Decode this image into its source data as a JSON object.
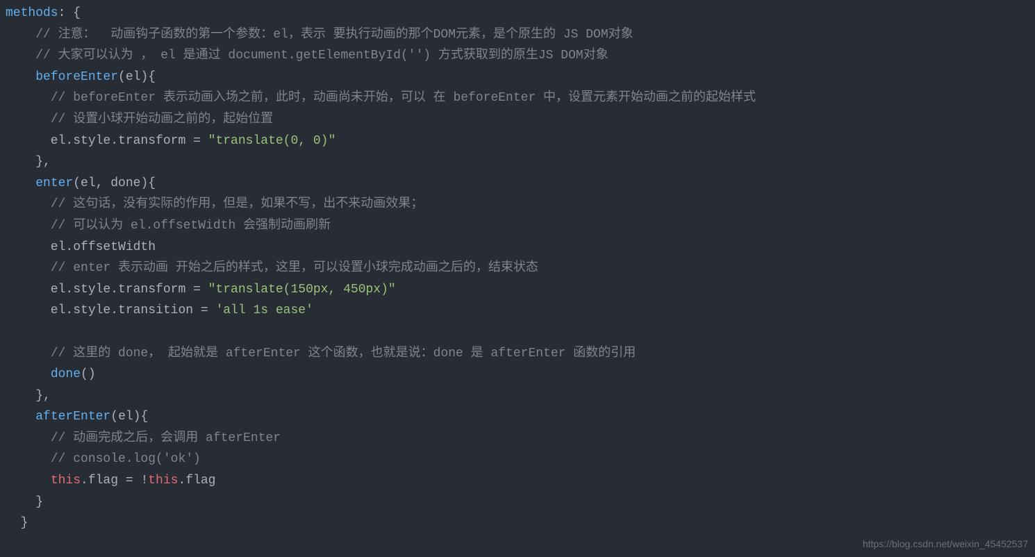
{
  "lines": [
    {
      "segments": [
        {
          "cls": "method",
          "text": "methods"
        },
        {
          "cls": "punct",
          "text": ": {"
        }
      ]
    },
    {
      "segments": [
        {
          "cls": "plain",
          "text": "    "
        },
        {
          "cls": "comment",
          "text": "// 注意：  动画钩子函数的第一个参数：el，表示 要执行动画的那个DOM元素，是个原生的 JS DOM对象"
        }
      ]
    },
    {
      "segments": [
        {
          "cls": "plain",
          "text": "    "
        },
        {
          "cls": "comment",
          "text": "// 大家可以认为 ， el 是通过 document.getElementById('') 方式获取到的原生JS DOM对象"
        }
      ]
    },
    {
      "segments": [
        {
          "cls": "plain",
          "text": "    "
        },
        {
          "cls": "method",
          "text": "beforeEnter"
        },
        {
          "cls": "punct",
          "text": "("
        },
        {
          "cls": "param",
          "text": "el"
        },
        {
          "cls": "punct",
          "text": "){"
        }
      ]
    },
    {
      "segments": [
        {
          "cls": "plain",
          "text": "      "
        },
        {
          "cls": "comment",
          "text": "// beforeEnter 表示动画入场之前，此时，动画尚未开始，可以 在 beforeEnter 中，设置元素开始动画之前的起始样式"
        }
      ]
    },
    {
      "segments": [
        {
          "cls": "plain",
          "text": "      "
        },
        {
          "cls": "comment",
          "text": "// 设置小球开始动画之前的，起始位置"
        }
      ]
    },
    {
      "segments": [
        {
          "cls": "plain",
          "text": "      el.style.transform = "
        },
        {
          "cls": "string",
          "text": "\"translate(0, 0)\""
        }
      ]
    },
    {
      "segments": [
        {
          "cls": "plain",
          "text": "    },"
        }
      ]
    },
    {
      "segments": [
        {
          "cls": "plain",
          "text": "    "
        },
        {
          "cls": "method",
          "text": "enter"
        },
        {
          "cls": "punct",
          "text": "("
        },
        {
          "cls": "param",
          "text": "el, done"
        },
        {
          "cls": "punct",
          "text": "){"
        }
      ]
    },
    {
      "segments": [
        {
          "cls": "plain",
          "text": "      "
        },
        {
          "cls": "comment",
          "text": "// 这句话，没有实际的作用，但是，如果不写，出不来动画效果；"
        }
      ]
    },
    {
      "segments": [
        {
          "cls": "plain",
          "text": "      "
        },
        {
          "cls": "comment",
          "text": "// 可以认为 el.offsetWidth 会强制动画刷新"
        }
      ]
    },
    {
      "segments": [
        {
          "cls": "plain",
          "text": "      el.offsetWidth"
        }
      ]
    },
    {
      "segments": [
        {
          "cls": "plain",
          "text": "      "
        },
        {
          "cls": "comment",
          "text": "// enter 表示动画 开始之后的样式，这里，可以设置小球完成动画之后的，结束状态"
        }
      ]
    },
    {
      "segments": [
        {
          "cls": "plain",
          "text": "      el.style.transform = "
        },
        {
          "cls": "string",
          "text": "\"translate(150px, 450px)\""
        }
      ]
    },
    {
      "segments": [
        {
          "cls": "plain",
          "text": "      el.style.transition = "
        },
        {
          "cls": "string",
          "text": "'all 1s ease'"
        }
      ]
    },
    {
      "segments": [
        {
          "cls": "plain",
          "text": ""
        }
      ]
    },
    {
      "segments": [
        {
          "cls": "plain",
          "text": "      "
        },
        {
          "cls": "comment",
          "text": "// 这里的 done， 起始就是 afterEnter 这个函数，也就是说：done 是 afterEnter 函数的引用"
        }
      ]
    },
    {
      "segments": [
        {
          "cls": "plain",
          "text": "      "
        },
        {
          "cls": "method",
          "text": "done"
        },
        {
          "cls": "punct",
          "text": "()"
        }
      ]
    },
    {
      "segments": [
        {
          "cls": "plain",
          "text": "    },"
        }
      ]
    },
    {
      "segments": [
        {
          "cls": "plain",
          "text": "    "
        },
        {
          "cls": "method",
          "text": "afterEnter"
        },
        {
          "cls": "punct",
          "text": "("
        },
        {
          "cls": "param",
          "text": "el"
        },
        {
          "cls": "punct",
          "text": "){"
        }
      ]
    },
    {
      "segments": [
        {
          "cls": "plain",
          "text": "      "
        },
        {
          "cls": "comment",
          "text": "// 动画完成之后，会调用 afterEnter"
        }
      ]
    },
    {
      "segments": [
        {
          "cls": "plain",
          "text": "      "
        },
        {
          "cls": "comment",
          "text": "// console.log('ok')"
        }
      ]
    },
    {
      "segments": [
        {
          "cls": "plain",
          "text": "      "
        },
        {
          "cls": "this-kw",
          "text": "this"
        },
        {
          "cls": "plain",
          "text": ".flag = !"
        },
        {
          "cls": "this-kw",
          "text": "this"
        },
        {
          "cls": "plain",
          "text": ".flag"
        }
      ]
    },
    {
      "segments": [
        {
          "cls": "plain",
          "text": "    }"
        }
      ]
    },
    {
      "segments": [
        {
          "cls": "plain",
          "text": "  }"
        }
      ]
    }
  ],
  "watermark": "https://blog.csdn.net/weixin_45452537"
}
